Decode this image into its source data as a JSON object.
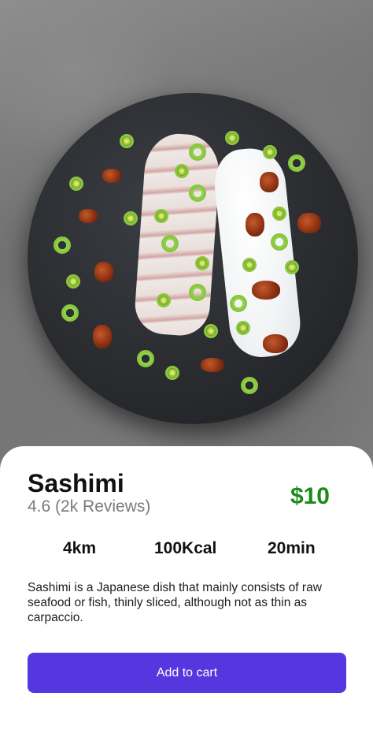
{
  "product": {
    "name": "Sashimi",
    "rating_text": "4.6 (2k Reviews)",
    "price": "$10"
  },
  "stats": [
    {
      "label": "4km"
    },
    {
      "label": "100Kcal"
    },
    {
      "label": "20min"
    }
  ],
  "description": "Sashimi is a Japanese dish that mainly consists of raw seafood or fish, thinly sliced, although not as thin as carpaccio.",
  "actions": {
    "add_to_cart_label": "Add to cart"
  },
  "colors": {
    "accent": "#5636df",
    "price": "#1a8a1a"
  },
  "images": {
    "hero": "sashimi-platter-photo"
  }
}
